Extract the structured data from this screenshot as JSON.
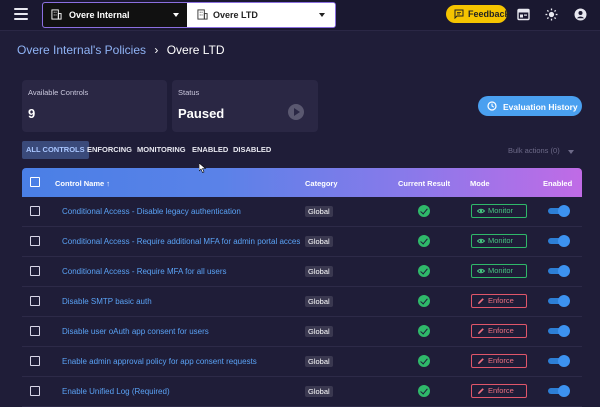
{
  "topbar": {
    "tenant_group": "Overe Internal",
    "tenant": "Overe LTD",
    "feedback_label": "Feedback"
  },
  "breadcrumb": {
    "parent": "Overe Internal's Policies",
    "separator": "›",
    "current": "Overe LTD"
  },
  "summary": {
    "available_controls_label": "Available Controls",
    "available_controls_value": "9",
    "status_label": "Status",
    "status_value": "Paused"
  },
  "evaluation_history_label": "Evaluation History",
  "tabs": [
    {
      "label": "ALL CONTROLS",
      "active": true
    },
    {
      "label": "ENFORCING",
      "active": false
    },
    {
      "label": "MONITORING",
      "active": false
    },
    {
      "label": "ENABLED",
      "active": false
    },
    {
      "label": "DISABLED",
      "active": false
    }
  ],
  "bulk_actions_label": "Bulk actions (0)",
  "table": {
    "columns": {
      "name": "Control Name ↑",
      "category": "Category",
      "result": "Current Result",
      "mode": "Mode",
      "enabled": "Enabled"
    },
    "rows": [
      {
        "name": "Conditional Access - Disable legacy authentication",
        "category": "Global",
        "mode": "Monitor"
      },
      {
        "name": "Conditional Access - Require additional MFA for admin portal access",
        "category": "Global",
        "mode": "Monitor"
      },
      {
        "name": "Conditional Access - Require MFA for all users",
        "category": "Global",
        "mode": "Monitor"
      },
      {
        "name": "Disable SMTP basic auth",
        "category": "Global",
        "mode": "Enforce"
      },
      {
        "name": "Disable user oAuth app consent for users",
        "category": "Global",
        "mode": "Enforce"
      },
      {
        "name": "Enable admin approval policy for app consent requests",
        "category": "Global",
        "mode": "Enforce"
      },
      {
        "name": "Enable Unified Log (Required)",
        "category": "Global",
        "mode": "Enforce"
      }
    ]
  },
  "colors": {
    "background": "#1f1d38",
    "accent_blue": "#4aa0f0",
    "feedback_yellow": "#f5c400",
    "monitor_green": "#2fb86a",
    "enforce_red": "#e0566a",
    "link_blue": "#5aa2f5"
  },
  "icons": [
    "menu-icon",
    "building-icon",
    "feedback-icon",
    "dashboard-icon",
    "sun-icon",
    "account-icon",
    "play-icon",
    "history-icon",
    "eye-icon",
    "pencil-icon",
    "check-circle-icon"
  ]
}
